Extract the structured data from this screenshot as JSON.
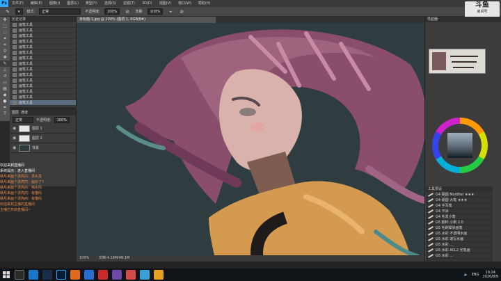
{
  "menubar": {
    "logo": "Ps",
    "items": [
      "文件(F)",
      "编辑(E)",
      "图像(I)",
      "图层(L)",
      "类型(Y)",
      "选择(S)",
      "滤镜(T)",
      "3D(D)",
      "视图(V)",
      "窗口(W)",
      "帮助(H)"
    ],
    "min": "—",
    "max": "□",
    "close": "✕"
  },
  "options": {
    "mode_label": "模式:",
    "mode_value": "正常",
    "opacity_label": "不透明度:",
    "opacity_value": "100%",
    "flow_label": "流量:",
    "flow_value": "100%"
  },
  "document": {
    "tab_title": "未标题-1.jpg @ 100% (图层 1, RGB/8#)",
    "zoom": "100%",
    "status": "文档:4.19M/48.1M"
  },
  "history": {
    "tab_label": "历史记录",
    "items": [
      "画笔工具",
      "画笔工具",
      "画笔工具",
      "画笔工具",
      "画笔工具",
      "画笔工具",
      "画笔工具",
      "画笔工具",
      "画笔工具",
      "画笔工具",
      "画笔工具",
      "画笔工具",
      "画笔工具",
      "画笔工具",
      "画笔工具"
    ]
  },
  "layers": {
    "tabs": [
      "图层",
      "通道"
    ],
    "blend": "正常",
    "opacity_label": "不透明度:",
    "opacity_value": "100%",
    "rows": [
      {
        "name": "图层 1"
      },
      {
        "name": "图层 2"
      },
      {
        "name": "背景"
      }
    ]
  },
  "chat": {
    "lines": [
      {
        "text": "欢迎来到直播间",
        "color": "#ffffff"
      },
      {
        "text": "系统提示：进入直播间",
        "color": "#ffffff"
      },
      {
        "text": "晴月来画个漂亮的：求头发",
        "color": "#e8894a"
      },
      {
        "text": "晴月来画个漂亮的：画好了?",
        "color": "#e8894a"
      },
      {
        "text": "晴月来画个漂亮的：喝水吗",
        "color": "#e8894a"
      },
      {
        "text": "晴月来画个漂亮的：有猫吗",
        "color": "#e8894a"
      },
      {
        "text": "晴月来画个漂亮的：有猫吗",
        "color": "#e8894a"
      },
      {
        "text": "欢迎来到主播的直播间",
        "color": "#e8894a"
      },
      {
        "text": "主播已开启直播间~",
        "color": "#e8894a"
      }
    ]
  },
  "watermark": {
    "title": "斗鱼",
    "sub": "房间号",
    "room_id": "7846433"
  },
  "right": {
    "nav_label": "导航器",
    "brush_label": "工具预设",
    "brushes": [
      "G4 硬圆 Modifier ★★★",
      "G4 硬圆 大笔 ★★★",
      "G4 手写笔",
      "G4 平涂",
      "G4 毛发小笔",
      "G5 颜料 小刷 2.0",
      "G5 毛刷晕染画笔",
      "G5 水彩 不透明水画",
      "G5 水彩 速写水画",
      "G5 水彩 ...",
      "G5 水彩 ACL2 光笔画",
      "G5 水彩 ..."
    ]
  },
  "taskbar": {
    "time": "19:24",
    "date": "2020/8/9",
    "lang": "ENG"
  },
  "colors": {
    "accent": "#31a8ff",
    "chat_orange": "#e8894a"
  }
}
